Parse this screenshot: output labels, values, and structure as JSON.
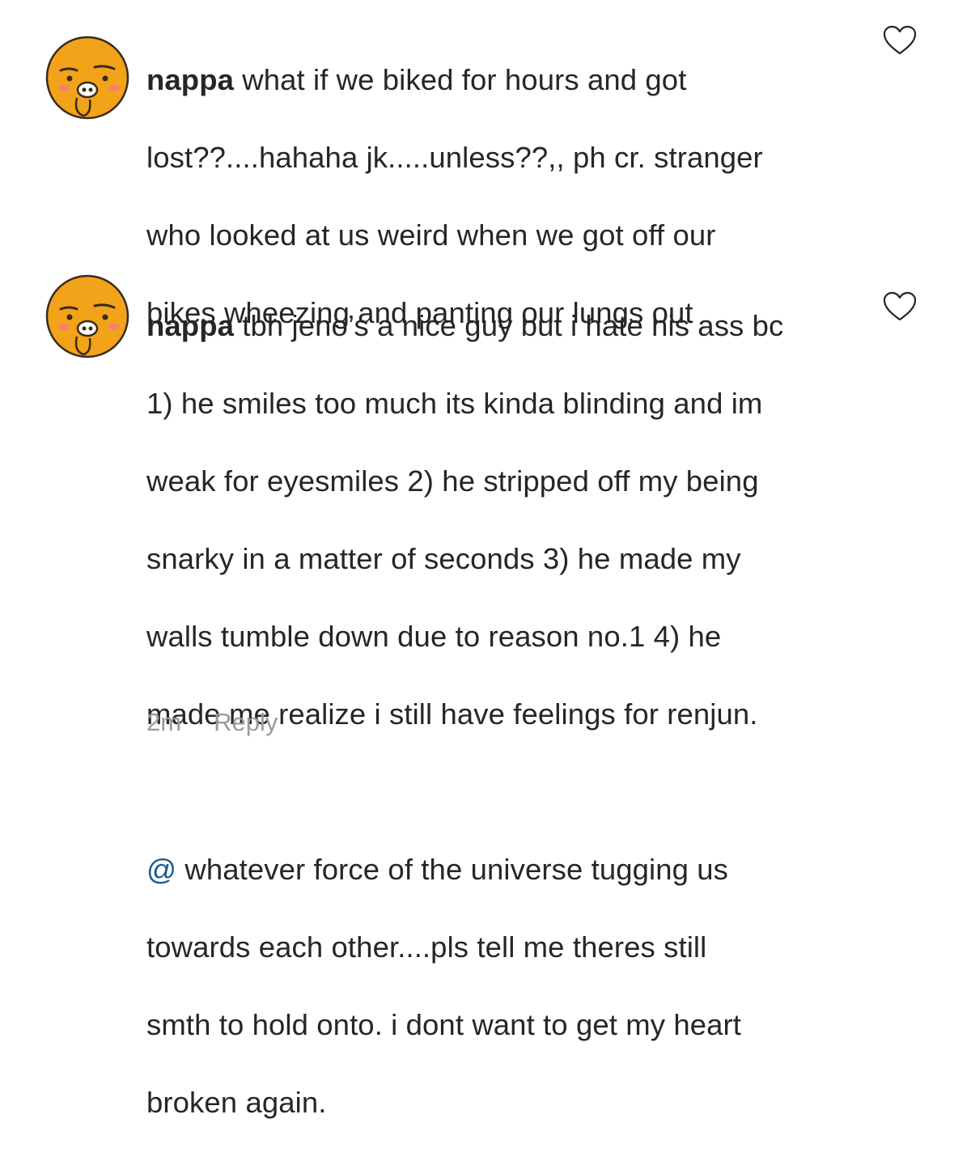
{
  "comments": [
    {
      "username": "nappa",
      "avatar_icon": "ryan-bear-avatar",
      "like_icon": "heart-outline-icon",
      "lines": [
        " what if we biked for hours and got",
        "lost??....hahaha jk.....unless??,, ph cr. stranger",
        "who looked at us weird when we got off our",
        "bikes wheezing and panting our lungs out"
      ]
    },
    {
      "username": "nappa",
      "avatar_icon": "ryan-bear-avatar",
      "like_icon": "heart-outline-icon",
      "lines": [
        " tbh jeno’s a nice guy but i hate his ass bc",
        "1) he smiles too much its kinda blinding and im",
        "weak for eyesmiles 2) he stripped off my being",
        "snarky in a matter of seconds 3) he made my",
        "walls tumble down due to reason no.1 4) he",
        "made me realize i still have feelings for renjun."
      ],
      "mention": "@",
      "mention_lines": [
        " whatever force of the universe tugging us",
        "towards each other....pls tell me theres still",
        "smth to hold onto. i dont want to get my heart",
        "broken again."
      ],
      "timestamp": "2m",
      "reply_label": "Reply"
    }
  ],
  "colors": {
    "text": "#262626",
    "meta": "#9a9a9a",
    "mention": "#1b5a8e",
    "avatar_fill": "#f5a623"
  }
}
